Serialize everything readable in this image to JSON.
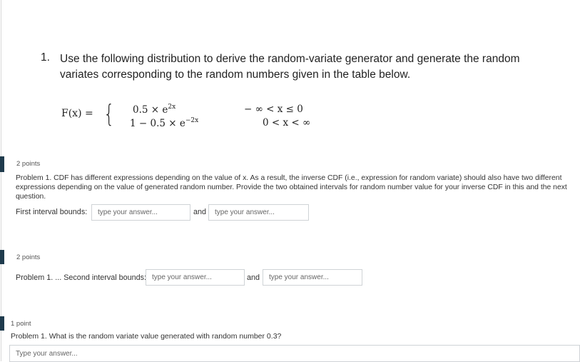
{
  "question": {
    "number": "1.",
    "text": "Use the following distribution to derive the random-variate generator and generate the random variates corresponding to the random numbers given in the table below."
  },
  "formula": {
    "fx": "F(x) = ",
    "brace": "{",
    "expr1_base": "0.5 × e",
    "expr1_exp": "2x",
    "expr2_base": "1 − 0.5 × e",
    "expr2_exp": "−2x",
    "cond1": "− ∞ <  x  ≤ 0",
    "cond2": "0 < x <  ∞"
  },
  "sections": [
    {
      "points": "2 points",
      "problem_text": "Problem 1. CDF has different expressions depending on the value of x. As a result, the inverse CDF (i.e., expression for random variate) should also have two different expressions depending on the value of generated random number. Provide the two obtained intervals for random number value for your inverse CDF in this and the next question.",
      "label": "First interval bounds:",
      "and": "and",
      "placeholder1": "type your answer...",
      "placeholder2": "type your answer..."
    },
    {
      "points": "2 points",
      "label": "Problem 1. ... Second interval bounds:",
      "and": "and",
      "placeholder1": "type your answer...",
      "placeholder2": "type your answer..."
    },
    {
      "points": "1 point",
      "label": "Problem 1. What is the random variate value generated with random number 0.3?",
      "placeholder": "Type your answer..."
    }
  ],
  "colors": {
    "marker": "#1f3b4d",
    "input_border": "#cfd3d6"
  }
}
